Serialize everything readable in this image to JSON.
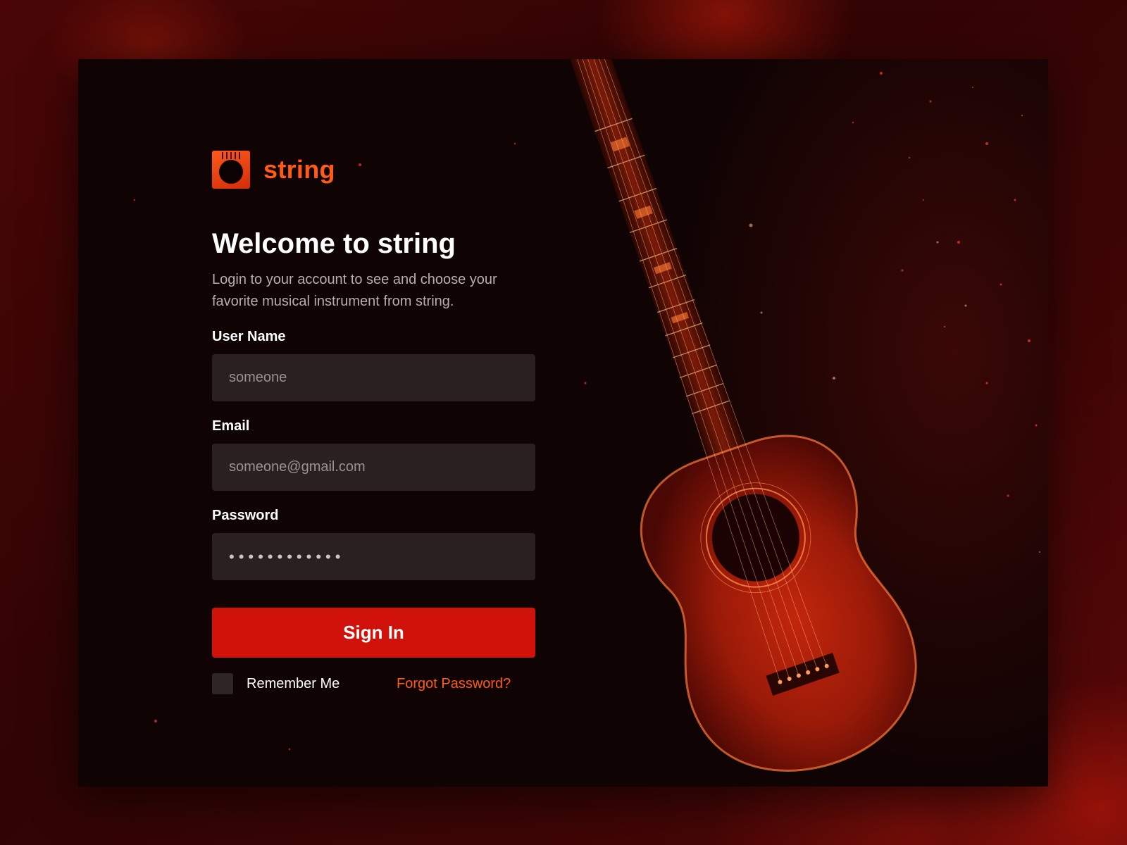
{
  "brand": {
    "name": "string"
  },
  "heading": {
    "title": "Welcome to string",
    "subtitle": "Login to your account to see and choose your favorite musical instrument from string."
  },
  "form": {
    "username": {
      "label": "User Name",
      "placeholder": "someone"
    },
    "email": {
      "label": "Email",
      "placeholder": "someone@gmail.com"
    },
    "password": {
      "label": "Password",
      "value": "••••••••••••"
    },
    "submit_label": "Sign In",
    "remember_label": "Remember Me",
    "remember_checked": false,
    "forgot_label": "Forgot Password?"
  },
  "colors": {
    "accent": "#ff5a16",
    "button": "#d0120a",
    "card_bg": "#0f0304",
    "field_bg": "#2a2022"
  },
  "icons": {
    "logo": "guitar-soundhole-icon"
  }
}
